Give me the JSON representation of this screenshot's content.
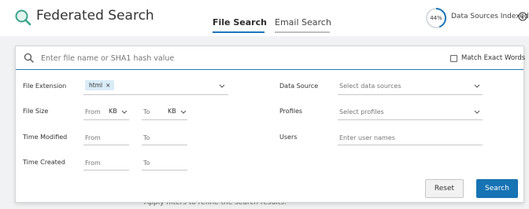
{
  "app": {
    "title": "Federated Search",
    "brand_icon": "search-icon",
    "accent_color": "#1a76b8",
    "brand_color": "#3aa58d"
  },
  "tabs": [
    {
      "label": "File Search",
      "active": true
    },
    {
      "label": "Email Search",
      "active": false
    }
  ],
  "indexed": {
    "percent_label": "44%",
    "fraction": 0.44,
    "label": "Data Sources Indexed",
    "info_icon": "info-icon"
  },
  "backdrop": {
    "hint_text": "Apply filters to refine the search results."
  },
  "search": {
    "placeholder": "Enter file name or SHA1 hash value",
    "value": "",
    "exact_match_label": "Match Exact Words",
    "exact_match_checked": false
  },
  "filters": {
    "file_extension": {
      "label": "File Extension",
      "chip": "html",
      "chip_remove": "×"
    },
    "file_size": {
      "label": "File Size",
      "from": "From",
      "from_unit": "KB",
      "to": "To",
      "to_unit": "KB"
    },
    "time_modified": {
      "label": "Time Modified",
      "from": "From",
      "to": "To"
    },
    "time_created": {
      "label": "Time Created",
      "from": "From",
      "to": "To"
    },
    "data_source": {
      "label": "Data Source",
      "placeholder": "Select data sources"
    },
    "profiles": {
      "label": "Profiles",
      "placeholder": "Select profiles"
    },
    "users": {
      "label": "Users",
      "placeholder": "Enter user names"
    }
  },
  "actions": {
    "reset_label": "Reset",
    "search_label": "Search"
  }
}
